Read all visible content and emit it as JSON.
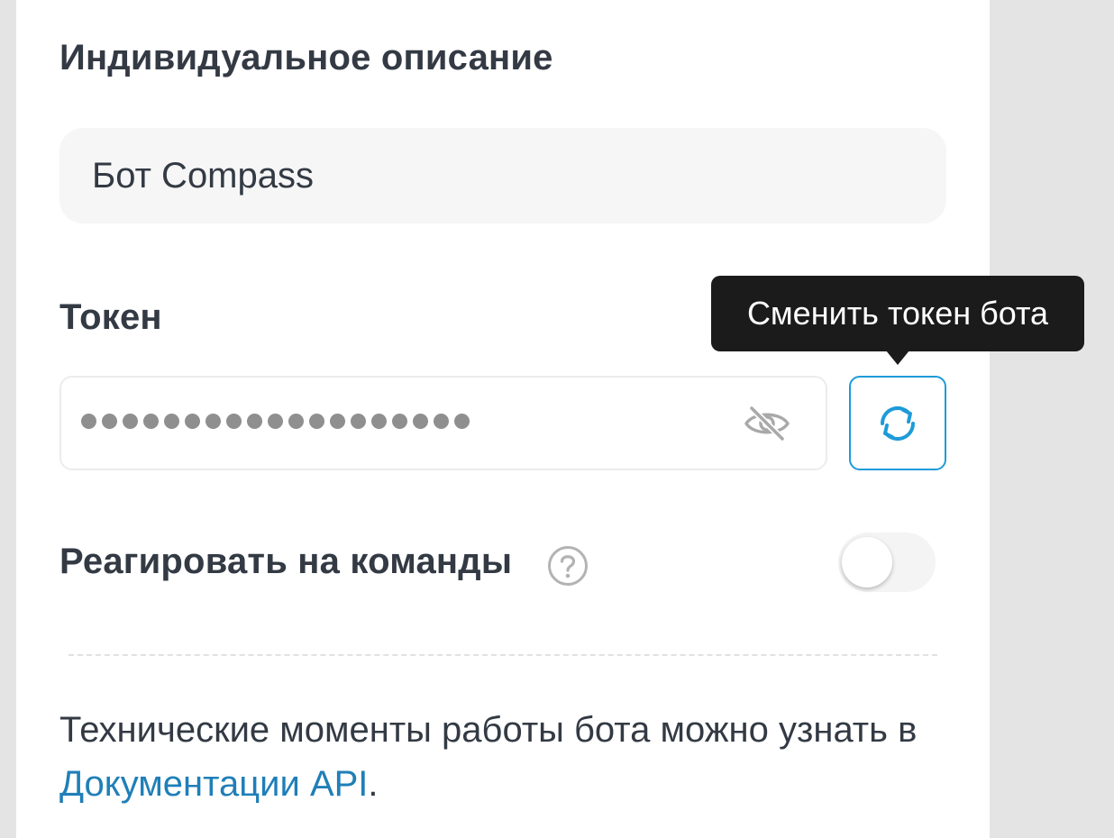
{
  "description_section": {
    "title": "Индивидуальное описание",
    "value": "Бот Compass"
  },
  "token_section": {
    "title": "Токен",
    "masked_value": "•••••••••••••••••••",
    "visibility_icon": "eye-slash-icon",
    "refresh_icon": "refresh-icon",
    "tooltip": "Сменить токен бота"
  },
  "commands_section": {
    "label": "Реагировать на команды",
    "help_icon": "question-circle-icon",
    "toggle_on": false
  },
  "footer": {
    "text_before": "Технические моменты работы бота можно узнать в ",
    "link_text": "Документации API",
    "text_after": "."
  },
  "colors": {
    "accent": "#1d9bd9",
    "link": "#1f7fb8",
    "text": "#333a44",
    "tooltip_bg": "#1b1b1b"
  }
}
